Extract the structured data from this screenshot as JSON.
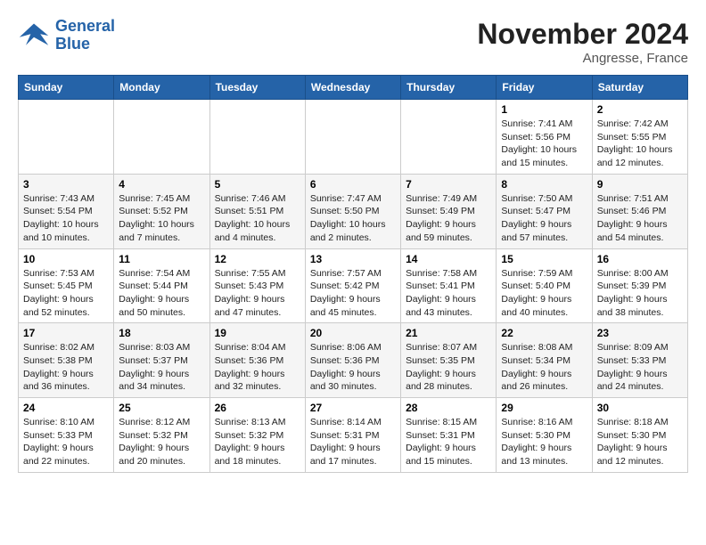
{
  "header": {
    "logo_line1": "General",
    "logo_line2": "Blue",
    "month": "November 2024",
    "location": "Angresse, France"
  },
  "weekdays": [
    "Sunday",
    "Monday",
    "Tuesday",
    "Wednesday",
    "Thursday",
    "Friday",
    "Saturday"
  ],
  "weeks": [
    [
      {
        "day": "",
        "info": ""
      },
      {
        "day": "",
        "info": ""
      },
      {
        "day": "",
        "info": ""
      },
      {
        "day": "",
        "info": ""
      },
      {
        "day": "",
        "info": ""
      },
      {
        "day": "1",
        "info": "Sunrise: 7:41 AM\nSunset: 5:56 PM\nDaylight: 10 hours and 15 minutes."
      },
      {
        "day": "2",
        "info": "Sunrise: 7:42 AM\nSunset: 5:55 PM\nDaylight: 10 hours and 12 minutes."
      }
    ],
    [
      {
        "day": "3",
        "info": "Sunrise: 7:43 AM\nSunset: 5:54 PM\nDaylight: 10 hours and 10 minutes."
      },
      {
        "day": "4",
        "info": "Sunrise: 7:45 AM\nSunset: 5:52 PM\nDaylight: 10 hours and 7 minutes."
      },
      {
        "day": "5",
        "info": "Sunrise: 7:46 AM\nSunset: 5:51 PM\nDaylight: 10 hours and 4 minutes."
      },
      {
        "day": "6",
        "info": "Sunrise: 7:47 AM\nSunset: 5:50 PM\nDaylight: 10 hours and 2 minutes."
      },
      {
        "day": "7",
        "info": "Sunrise: 7:49 AM\nSunset: 5:49 PM\nDaylight: 9 hours and 59 minutes."
      },
      {
        "day": "8",
        "info": "Sunrise: 7:50 AM\nSunset: 5:47 PM\nDaylight: 9 hours and 57 minutes."
      },
      {
        "day": "9",
        "info": "Sunrise: 7:51 AM\nSunset: 5:46 PM\nDaylight: 9 hours and 54 minutes."
      }
    ],
    [
      {
        "day": "10",
        "info": "Sunrise: 7:53 AM\nSunset: 5:45 PM\nDaylight: 9 hours and 52 minutes."
      },
      {
        "day": "11",
        "info": "Sunrise: 7:54 AM\nSunset: 5:44 PM\nDaylight: 9 hours and 50 minutes."
      },
      {
        "day": "12",
        "info": "Sunrise: 7:55 AM\nSunset: 5:43 PM\nDaylight: 9 hours and 47 minutes."
      },
      {
        "day": "13",
        "info": "Sunrise: 7:57 AM\nSunset: 5:42 PM\nDaylight: 9 hours and 45 minutes."
      },
      {
        "day": "14",
        "info": "Sunrise: 7:58 AM\nSunset: 5:41 PM\nDaylight: 9 hours and 43 minutes."
      },
      {
        "day": "15",
        "info": "Sunrise: 7:59 AM\nSunset: 5:40 PM\nDaylight: 9 hours and 40 minutes."
      },
      {
        "day": "16",
        "info": "Sunrise: 8:00 AM\nSunset: 5:39 PM\nDaylight: 9 hours and 38 minutes."
      }
    ],
    [
      {
        "day": "17",
        "info": "Sunrise: 8:02 AM\nSunset: 5:38 PM\nDaylight: 9 hours and 36 minutes."
      },
      {
        "day": "18",
        "info": "Sunrise: 8:03 AM\nSunset: 5:37 PM\nDaylight: 9 hours and 34 minutes."
      },
      {
        "day": "19",
        "info": "Sunrise: 8:04 AM\nSunset: 5:36 PM\nDaylight: 9 hours and 32 minutes."
      },
      {
        "day": "20",
        "info": "Sunrise: 8:06 AM\nSunset: 5:36 PM\nDaylight: 9 hours and 30 minutes."
      },
      {
        "day": "21",
        "info": "Sunrise: 8:07 AM\nSunset: 5:35 PM\nDaylight: 9 hours and 28 minutes."
      },
      {
        "day": "22",
        "info": "Sunrise: 8:08 AM\nSunset: 5:34 PM\nDaylight: 9 hours and 26 minutes."
      },
      {
        "day": "23",
        "info": "Sunrise: 8:09 AM\nSunset: 5:33 PM\nDaylight: 9 hours and 24 minutes."
      }
    ],
    [
      {
        "day": "24",
        "info": "Sunrise: 8:10 AM\nSunset: 5:33 PM\nDaylight: 9 hours and 22 minutes."
      },
      {
        "day": "25",
        "info": "Sunrise: 8:12 AM\nSunset: 5:32 PM\nDaylight: 9 hours and 20 minutes."
      },
      {
        "day": "26",
        "info": "Sunrise: 8:13 AM\nSunset: 5:32 PM\nDaylight: 9 hours and 18 minutes."
      },
      {
        "day": "27",
        "info": "Sunrise: 8:14 AM\nSunset: 5:31 PM\nDaylight: 9 hours and 17 minutes."
      },
      {
        "day": "28",
        "info": "Sunrise: 8:15 AM\nSunset: 5:31 PM\nDaylight: 9 hours and 15 minutes."
      },
      {
        "day": "29",
        "info": "Sunrise: 8:16 AM\nSunset: 5:30 PM\nDaylight: 9 hours and 13 minutes."
      },
      {
        "day": "30",
        "info": "Sunrise: 8:18 AM\nSunset: 5:30 PM\nDaylight: 9 hours and 12 minutes."
      }
    ]
  ]
}
